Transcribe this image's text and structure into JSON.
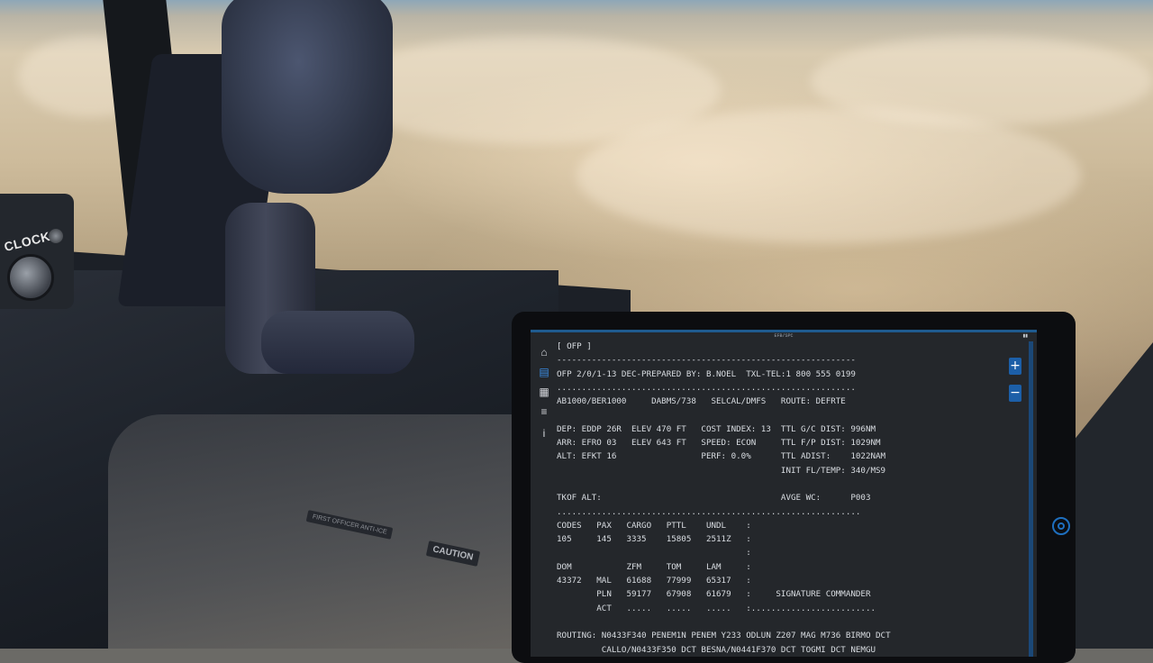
{
  "cockpit": {
    "clock_label": "CLOCK",
    "placard_1": "FIRST OFFICER ANTI-ICE",
    "placard_2": "CAUTION"
  },
  "efb": {
    "status_center": "EFB/SPC",
    "status_right": "▮▮",
    "sidebar": [
      {
        "icon": "home-icon",
        "glyph": "⌂",
        "active": false
      },
      {
        "icon": "document-icon",
        "glyph": "▤",
        "active": true
      },
      {
        "icon": "map-icon",
        "glyph": "▦",
        "active": false
      },
      {
        "icon": "sliders-icon",
        "glyph": "≡",
        "active": false
      },
      {
        "icon": "info-icon",
        "glyph": "i",
        "active": false
      }
    ],
    "zoom_in": "+",
    "zoom_out": "−",
    "ofp_lines": [
      "[ OFP ]",
      "------------------------------------------------------------",
      "OFP 2/0/1-13 DEC-PREPARED BY: B.NOEL  TXL-TEL:1 800 555 0199",
      "............................................................",
      "AB1000/BER1000     DABMS/738   SELCAL/DMFS   ROUTE: DEFRTE",
      "",
      "DEP: EDDP 26R  ELEV 470 FT   COST INDEX: 13  TTL G/C DIST: 996NM",
      "ARR: EFRO 03   ELEV 643 FT   SPEED: ECON     TTL F/P DIST: 1029NM",
      "ALT: EFKT 16                 PERF: 0.0%      TTL ADIST:    1022NAM",
      "                                             INIT FL/TEMP: 340/MS9",
      "",
      "TKOF ALT:                                    AVGE WC:      P003",
      ".............................................................",
      "CODES   PAX   CARGO   PTTL    UNDL    :",
      "105     145   3335    15805   2511Z   :",
      "                                      :",
      "DOM           ZFM     TOM     LAM     :",
      "43372   MAL   61688   77999   65317   :",
      "        PLN   59177   67908   61679   :     SIGNATURE COMMANDER",
      "        ACT   .....   .....   .....   :.........................",
      "",
      "ROUTING: N0433F340 PENEM1N PENEM Y233 ODLUN Z207 MAG M736 BIRMO DCT",
      "         CALLO/N0433F350 DCT BESNA/N0441F370 DCT TOGMI DCT NEMGU"
    ]
  }
}
